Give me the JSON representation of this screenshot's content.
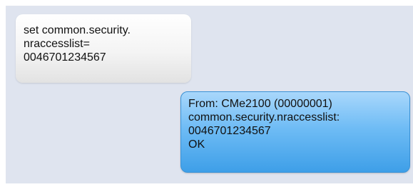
{
  "conversation": {
    "messages": [
      {
        "direction": "outgoing",
        "lines": [
          "set common.security.",
          "nraccesslist=",
          "0046701234567"
        ]
      },
      {
        "direction": "incoming",
        "lines": [
          "From: CMe2100 (00000001)",
          "common.security.nraccesslist:",
          "0046701234567",
          "OK"
        ]
      }
    ]
  },
  "colors": {
    "panel_background": "#dfe4ef",
    "outgoing_bubble": "#f4f4f4",
    "incoming_bubble": "#6fbcf5",
    "incoming_border": "#3a92d6",
    "text": "#111111"
  }
}
